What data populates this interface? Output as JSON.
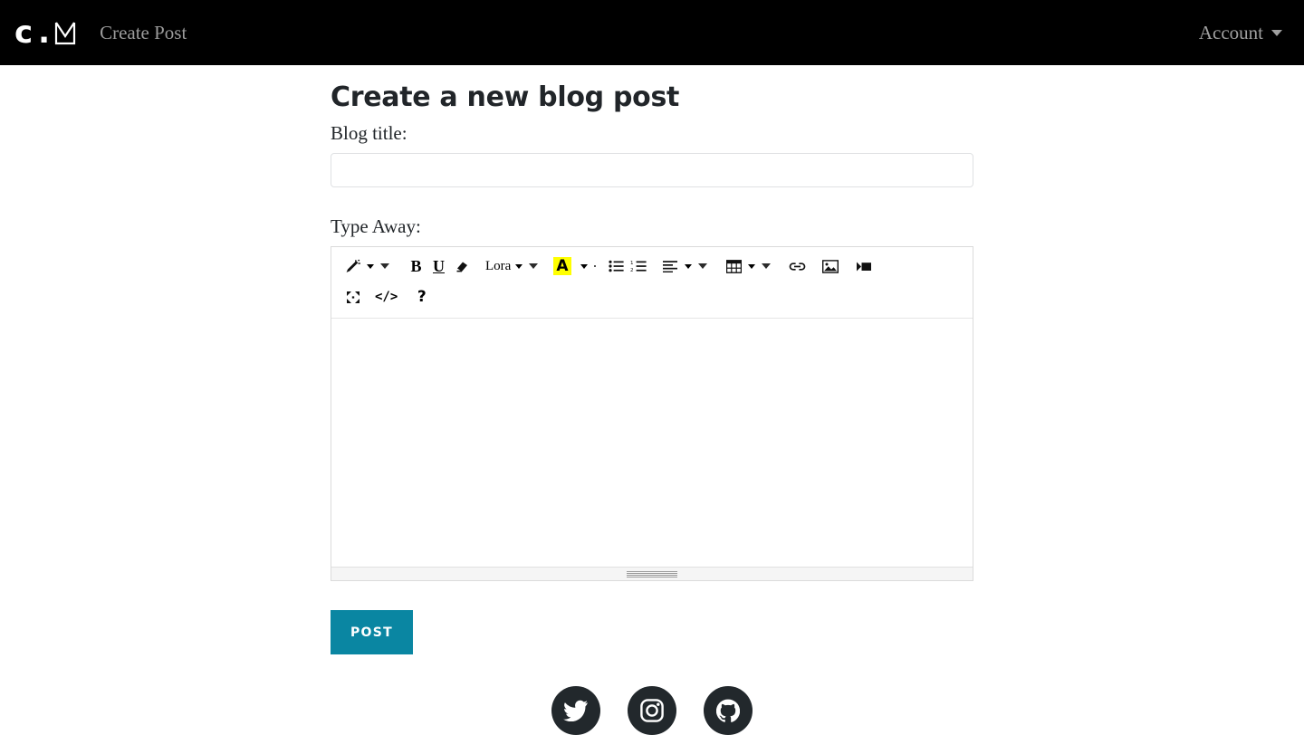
{
  "navbar": {
    "brand": {
      "letter": "c",
      "dot": ".",
      "mark_icon": "m-crown-logo-icon"
    },
    "link_label": "Create Post",
    "account_label": "Account",
    "account_caret_icon": "caret-down-icon"
  },
  "main": {
    "title": "Create a new blog post",
    "title_label": "Blog title:",
    "title_input_value": "",
    "title_input_placeholder": "",
    "body_label": "Type Away:",
    "submit_label": "POST"
  },
  "editor": {
    "font_name": "Lora",
    "body_value": "",
    "toolbar_row1": [
      {
        "name": "magic-wand-style-icon",
        "label": ""
      },
      {
        "name": "style-caret-icon",
        "label": ""
      },
      {
        "name": "bold-icon",
        "label": "B"
      },
      {
        "name": "underline-icon",
        "label": "U"
      },
      {
        "name": "remove-format-eraser-icon",
        "label": ""
      },
      {
        "name": "font-family-dropdown",
        "label": "Lora"
      },
      {
        "name": "font-family-caret-icon",
        "label": ""
      },
      {
        "name": "text-highlight-color-icon",
        "label": "A"
      },
      {
        "name": "text-color-caret-icon",
        "label": ""
      },
      {
        "name": "unordered-list-icon",
        "label": ""
      },
      {
        "name": "ordered-list-icon",
        "label": ""
      },
      {
        "name": "paragraph-align-icon",
        "label": ""
      },
      {
        "name": "paragraph-caret-icon",
        "label": ""
      },
      {
        "name": "table-icon",
        "label": ""
      },
      {
        "name": "table-caret-icon",
        "label": ""
      },
      {
        "name": "link-icon",
        "label": ""
      },
      {
        "name": "picture-icon",
        "label": ""
      },
      {
        "name": "video-icon",
        "label": ""
      }
    ],
    "toolbar_row2": [
      {
        "name": "fullscreen-icon",
        "label": ""
      },
      {
        "name": "code-view-icon",
        "label": "</>"
      },
      {
        "name": "help-icon",
        "label": "?"
      }
    ]
  },
  "footer": {
    "social_links": [
      {
        "name": "twitter-icon",
        "label": "Twitter"
      },
      {
        "name": "instagram-icon",
        "label": "Instagram"
      },
      {
        "name": "github-icon",
        "label": "GitHub"
      }
    ]
  },
  "colors": {
    "navbar_bg": "#000000",
    "accent_button": "#0a86a2",
    "highlight_yellow": "#ffff00",
    "page_text": "#212529",
    "nav_link": "#9b9b9b",
    "social_bg": "#22282c"
  }
}
